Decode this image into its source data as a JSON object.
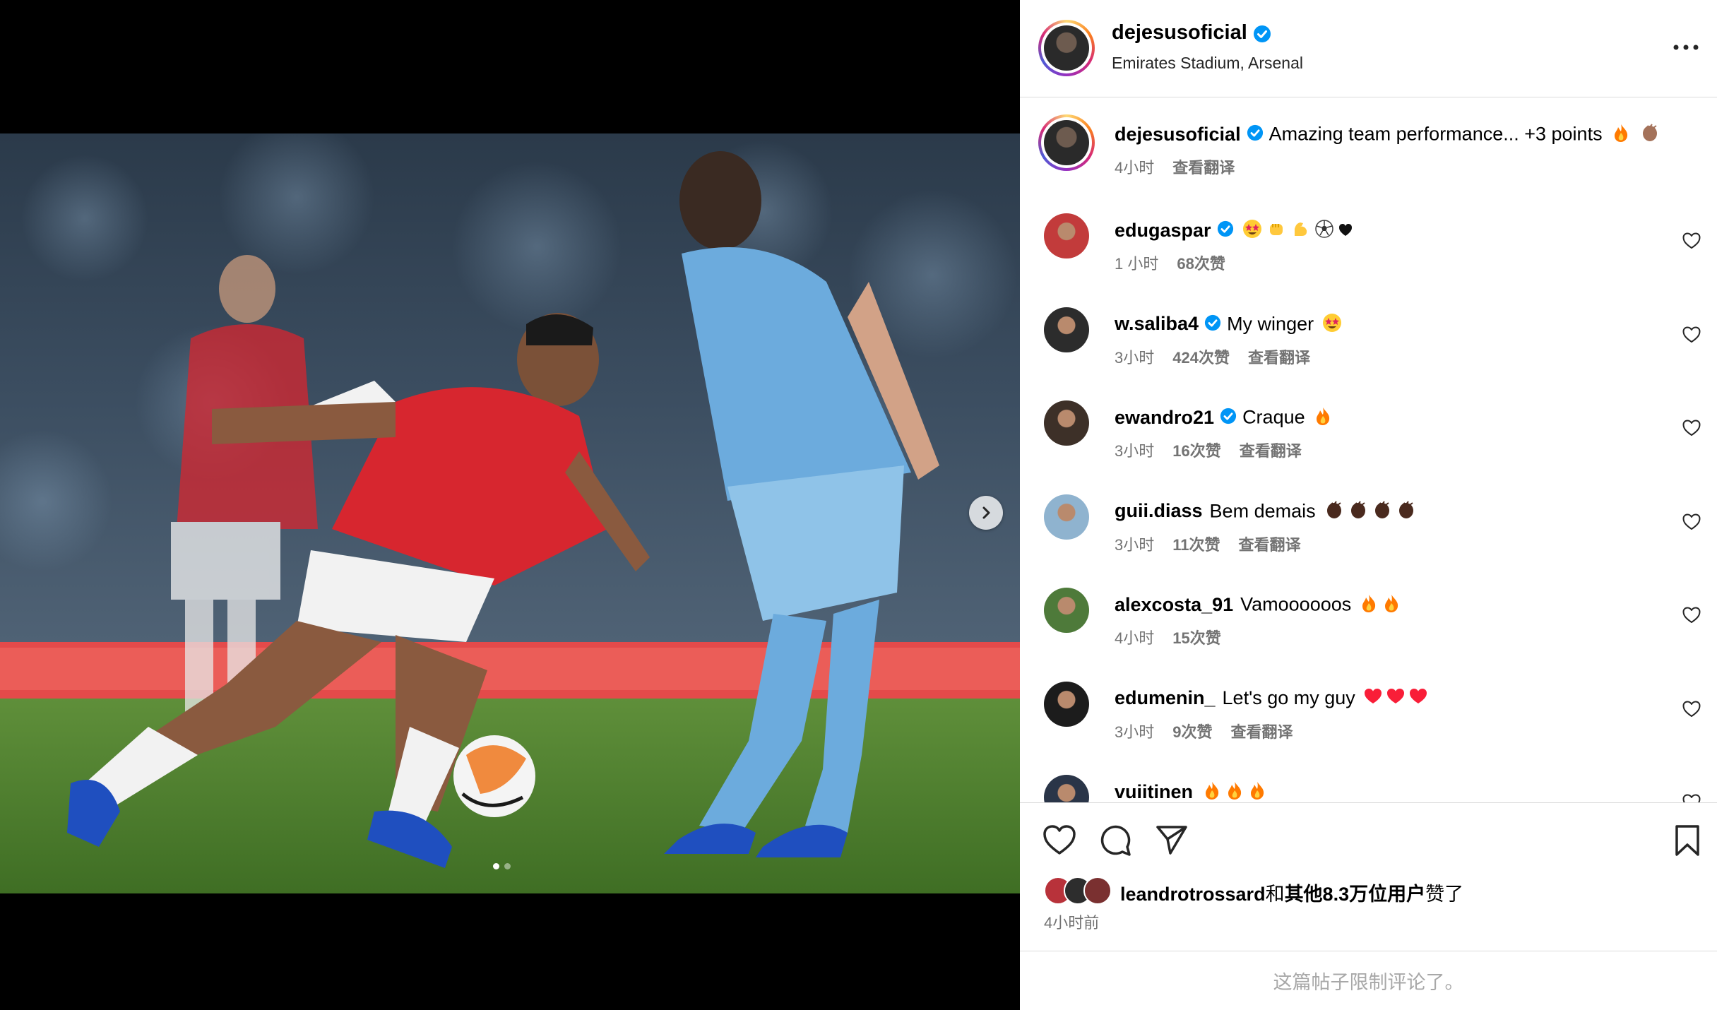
{
  "post": {
    "username": "dejesusoficial",
    "location": "Emirates Stadium, Arsenal",
    "caption": "Amazing team performance... +3 points",
    "caption_time": "4小时",
    "caption_translate": "查看翻译",
    "carousel": {
      "current_index": 1,
      "total": 2
    }
  },
  "comments": [
    {
      "user": "edugaspar",
      "verified": true,
      "text": "",
      "emojis": [
        "star-struck",
        "fist",
        "muscle",
        "soccer",
        "black-heart"
      ],
      "time": "1 小时",
      "likes": "68次赞",
      "translate": ""
    },
    {
      "user": "w.saliba4",
      "verified": true,
      "text": "My winger",
      "emojis": [
        "star-struck"
      ],
      "time": "3小时",
      "likes": "424次赞",
      "translate": "查看翻译"
    },
    {
      "user": "ewandro21",
      "verified": true,
      "text": "Craque",
      "emojis": [
        "fire"
      ],
      "time": "3小时",
      "likes": "16次赞",
      "translate": "查看翻译"
    },
    {
      "user": "guii.diass",
      "verified": false,
      "text": "Bem demais",
      "emojis": [
        "clap",
        "clap",
        "clap",
        "clap"
      ],
      "time": "3小时",
      "likes": "11次赞",
      "translate": "查看翻译"
    },
    {
      "user": "alexcosta_91",
      "verified": false,
      "text": "Vamoooooos",
      "emojis": [
        "fire",
        "fire"
      ],
      "time": "4小时",
      "likes": "15次赞",
      "translate": ""
    },
    {
      "user": "edumenin_",
      "verified": false,
      "text": "Let's go my guy",
      "emojis": [
        "red-heart",
        "red-heart",
        "red-heart"
      ],
      "time": "3小时",
      "likes": "9次赞",
      "translate": "查看翻译"
    },
    {
      "user": "vuiitinen",
      "verified": false,
      "text": "",
      "emojis": [
        "fire",
        "fire",
        "fire"
      ],
      "time": "",
      "likes": "",
      "translate": ""
    }
  ],
  "likes": {
    "liker": "leandrotrossard",
    "connector": "和",
    "others": "其他8.3万位用户",
    "suffix": "赞了",
    "time": "4小时前"
  },
  "footer": {
    "comments_limited": "这篇帖子限制评论了。"
  },
  "colors": {
    "verified": "#0095f6",
    "meta": "#737373",
    "border": "#dbdbdb"
  }
}
